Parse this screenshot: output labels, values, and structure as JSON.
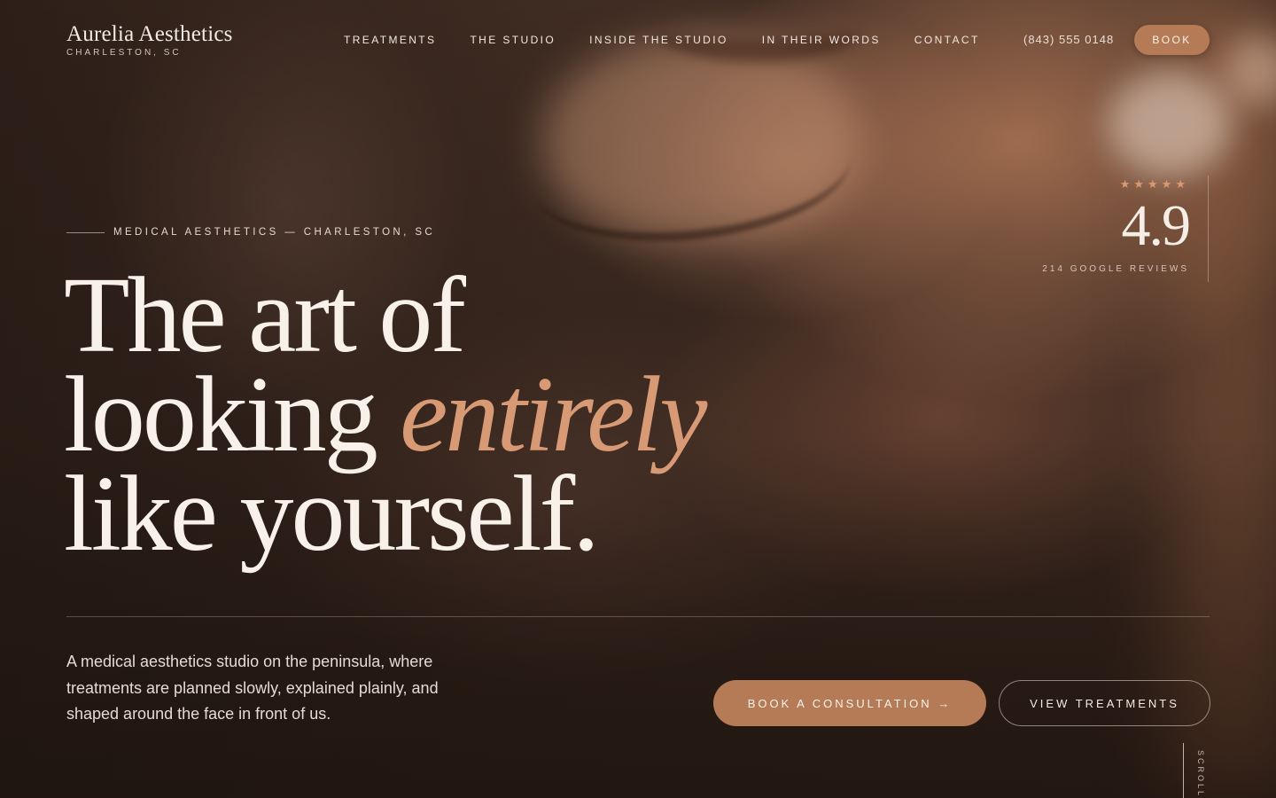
{
  "brand": {
    "name": "Aurelia Aesthetics",
    "location": "CHARLESTON, SC"
  },
  "nav": {
    "items": [
      {
        "label": "TREATMENTS"
      },
      {
        "label": "THE STUDIO"
      },
      {
        "label": "INSIDE THE STUDIO"
      },
      {
        "label": "IN THEIR WORDS"
      },
      {
        "label": "CONTACT"
      }
    ],
    "phone": "(843) 555 0148",
    "book_label": "BOOK"
  },
  "rating": {
    "stars": "★★★★★",
    "star_count": 5,
    "score": "4.9",
    "reviews": "214 GOOGLE REVIEWS"
  },
  "hero": {
    "eyebrow": "MEDICAL AESTHETICS — CHARLESTON, SC",
    "headline_line1": "The art of",
    "headline_line2_plain": "looking",
    "headline_line2_emphasis": "entirely",
    "headline_line3": "like yourself.",
    "lede": "A medical aesthetics studio on the peninsula, where treatments are planned slowly, explained plainly, and shaped around the face in front of us.",
    "cta_primary": "BOOK A CONSULTATION →",
    "cta_secondary": "VIEW TREATMENTS",
    "scroll_label": "SCROLL"
  },
  "colors": {
    "accent": "#b57a56",
    "emphasis": "#d79a74",
    "star": "#d99a72",
    "text": "#f3ebe3"
  }
}
